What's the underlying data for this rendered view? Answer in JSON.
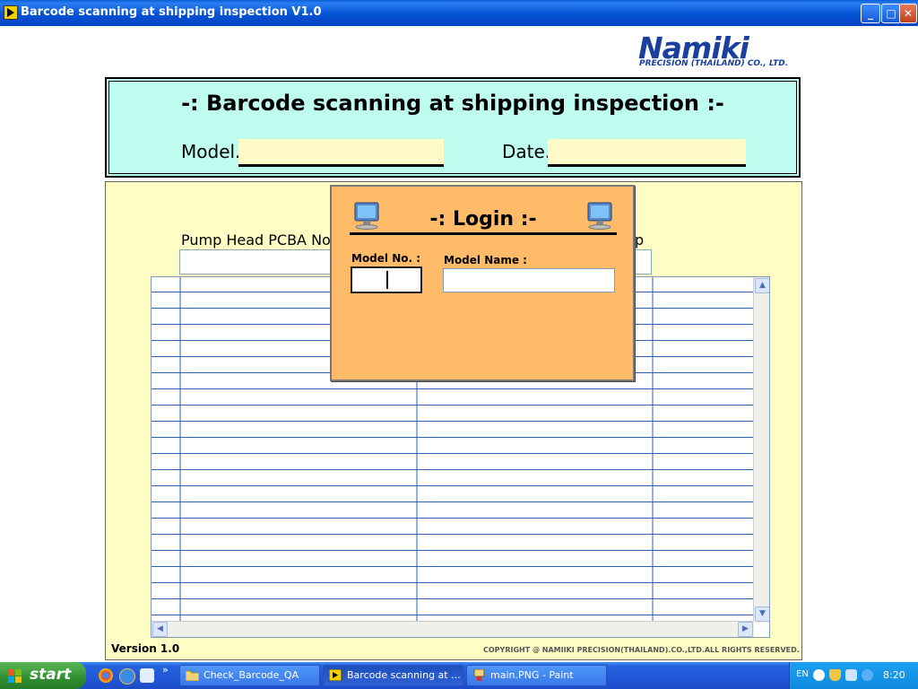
{
  "window": {
    "title": "Barcode scanning at shipping inspection V1.0",
    "minimize_glyph": "_",
    "maximize_glyph": "□",
    "close_glyph": "✕"
  },
  "logo": {
    "word": "Namiki",
    "sub": "PRECISION (THAILAND) CO., LTD."
  },
  "header": {
    "title": "-: Barcode scanning at shipping inspection :-",
    "model_label": "Model.",
    "model_value": "",
    "date_label": "Date.",
    "date_value": ""
  },
  "table": {
    "visible_columns": [
      "Pump Head PCBA No",
      "p"
    ],
    "rows": []
  },
  "login": {
    "title": "-: Login :-",
    "model_no_label": "Model No. :",
    "model_no_value": "",
    "model_name_label": "Model Name :",
    "model_name_value": ""
  },
  "footer": {
    "version": "Version 1.0",
    "copyright": "COPYRIGHT @    NAMIIKI PRECISION(THAILAND).CO.,LTD.ALL RIGHTS RESERVED."
  },
  "taskbar": {
    "start_label": "start",
    "more_glyph": "»",
    "tasks": [
      {
        "label": "Check_Barcode_QA",
        "icon": "folder-icon"
      },
      {
        "label": "Barcode scanning at ...",
        "icon": "labview-icon"
      },
      {
        "label": "main.PNG - Paint",
        "icon": "paint-icon"
      }
    ],
    "tray": {
      "language": "EN",
      "clock": "8:20"
    }
  },
  "colors": {
    "header_bg": "#bffcf0",
    "main_bg": "#fffdc4",
    "field_bg": "#fffac8",
    "login_bg": "#ffbb68",
    "grid_line": "#2e5fb4",
    "brand": "#1a3f9e"
  }
}
